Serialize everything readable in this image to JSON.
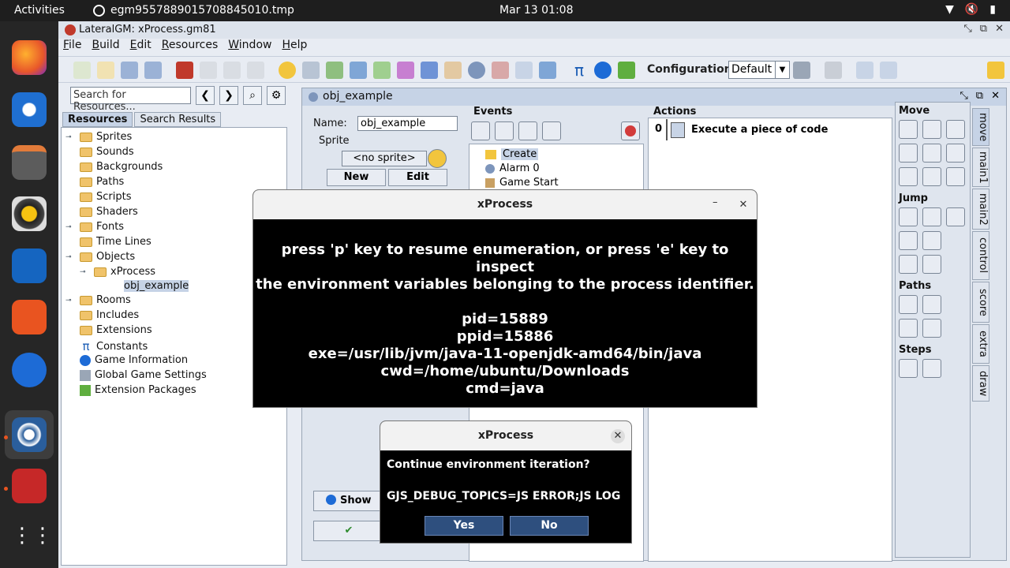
{
  "topbar": {
    "activities": "Activities",
    "window_title": "egm9557889015708845010.tmp",
    "clock": "Mar 13  01:08"
  },
  "app": {
    "title": "LateralGM: xProcess.gm81",
    "menu": [
      "File",
      "Build",
      "Edit",
      "Resources",
      "Window",
      "Help"
    ],
    "config_label": "Configuration:",
    "config_value": "Default"
  },
  "resources": {
    "search_placeholder": "Search for Resources...",
    "tabs": [
      "Resources",
      "Search Results"
    ],
    "tree": {
      "sprites": "Sprites",
      "sounds": "Sounds",
      "backgrounds": "Backgrounds",
      "paths": "Paths",
      "scripts": "Scripts",
      "shaders": "Shaders",
      "fonts": "Fonts",
      "timelines": "Time Lines",
      "objects": "Objects",
      "xprocess": "xProcess",
      "obj_example": "obj_example",
      "rooms": "Rooms",
      "includes": "Includes",
      "extensions": "Extensions",
      "constants": "Constants",
      "game_info": "Game Information",
      "global_settings": "Global Game Settings",
      "ext_packages": "Extension Packages"
    }
  },
  "object": {
    "title": "obj_example",
    "name_label": "Name:",
    "name_value": "obj_example",
    "sprite_label": "Sprite",
    "sprite_value": "<no sprite>",
    "new_label": "New",
    "edit_label": "Edit",
    "show_label": "Show",
    "events_label": "Events",
    "events": [
      "Create",
      "Alarm 0",
      "Game Start"
    ],
    "actions_label": "Actions",
    "action_index": "0",
    "action_text": "Execute a piece of code"
  },
  "palette": {
    "sections": {
      "move": "Move",
      "jump": "Jump",
      "paths": "Paths",
      "steps": "Steps"
    },
    "tabs": [
      "move",
      "main1",
      "main2",
      "control",
      "score",
      "extra",
      "draw"
    ]
  },
  "dialog_main": {
    "title": "xProcess",
    "line1": "press 'p' key to resume enumeration, or press 'e' key to inspect",
    "line2": "the environment variables belonging to the process identifier.",
    "pid": "pid=15889",
    "ppid": "ppid=15886",
    "exe": "exe=/usr/lib/jvm/java-11-openjdk-amd64/bin/java",
    "cwd": "cwd=/home/ubuntu/Downloads",
    "cmd": "cmd=java"
  },
  "dialog_confirm": {
    "title": "xProcess",
    "question": "Continue environment iteration?",
    "value": "GJS_DEBUG_TOPICS=JS ERROR;JS LOG",
    "yes": "Yes",
    "no": "No"
  },
  "colors": {
    "accent_blue": "#2e4f7e",
    "selection": "#c6d3e6",
    "ubuntu_orange": "#e95420"
  }
}
